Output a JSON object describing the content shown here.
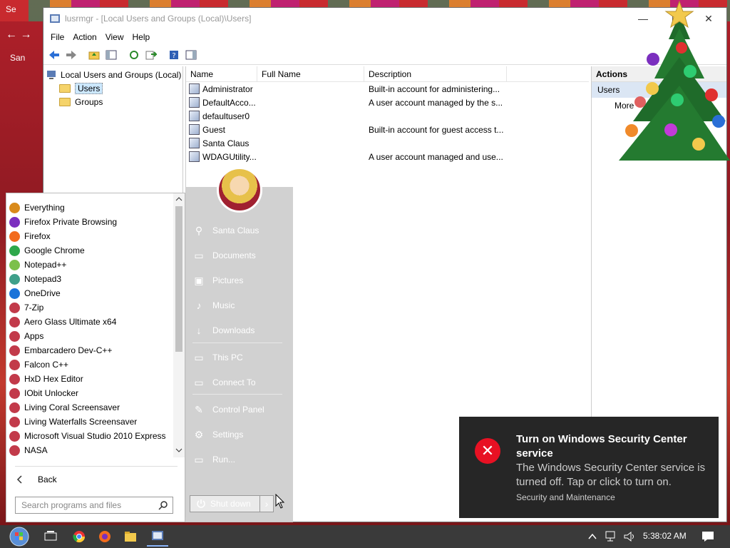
{
  "desktop": {
    "sec": "Se",
    "nav": "←  →",
    "san": "San"
  },
  "window": {
    "title": "lusrmgr - [Local Users and Groups (Local)\\Users]",
    "controls": {
      "minimize": "—",
      "maximize": "☐",
      "close": "✕"
    }
  },
  "menu": [
    "File",
    "Action",
    "View",
    "Help"
  ],
  "tree": {
    "root": "Local Users and Groups (Local)",
    "users": "Users",
    "groups": "Groups"
  },
  "list": {
    "headers": [
      "Name",
      "Full Name",
      "Description"
    ],
    "rows": [
      {
        "name": "Administrator",
        "full": "",
        "desc": "Built-in account for administering..."
      },
      {
        "name": "DefaultAcco...",
        "full": "",
        "desc": "A user account managed by the s..."
      },
      {
        "name": "defaultuser0",
        "full": "",
        "desc": ""
      },
      {
        "name": "Guest",
        "full": "",
        "desc": "Built-in account for guest access t..."
      },
      {
        "name": "Santa Claus",
        "full": "",
        "desc": ""
      },
      {
        "name": "WDAGUtility...",
        "full": "",
        "desc": "A user account managed and use..."
      }
    ]
  },
  "actions": {
    "header": "Actions",
    "users": "Users",
    "more": "More"
  },
  "start": {
    "programs": [
      {
        "label": "Everything",
        "color": "#d98a1a"
      },
      {
        "label": "Firefox Private Browsing",
        "color": "#7b2fbf"
      },
      {
        "label": "Firefox",
        "color": "#f26b1d"
      },
      {
        "label": "Google Chrome",
        "color": "#2ea84a"
      },
      {
        "label": "Notepad++",
        "color": "#7cc04a"
      },
      {
        "label": "Notepad3",
        "color": "#3fa08a"
      },
      {
        "label": "OneDrive",
        "color": "#1a73d9"
      },
      {
        "label": "7-Zip",
        "color": "#c23a4a"
      },
      {
        "label": "Aero Glass Ultimate x64",
        "color": "#c23a4a"
      },
      {
        "label": "Apps",
        "color": "#c23a4a"
      },
      {
        "label": "Embarcadero Dev-C++",
        "color": "#c23a4a"
      },
      {
        "label": "Falcon C++",
        "color": "#c23a4a"
      },
      {
        "label": "HxD Hex Editor",
        "color": "#c23a4a"
      },
      {
        "label": "IObit Unlocker",
        "color": "#c23a4a"
      },
      {
        "label": "Living Coral Screensaver",
        "color": "#c23a4a"
      },
      {
        "label": "Living Waterfalls Screensaver",
        "color": "#c23a4a"
      },
      {
        "label": "Microsoft Visual Studio 2010 Express",
        "color": "#c23a4a"
      },
      {
        "label": "NASA",
        "color": "#c23a4a"
      }
    ],
    "back": "Back",
    "search_placeholder": "Search programs and files",
    "right": [
      {
        "label": "Santa Claus",
        "icon": "⚲"
      },
      {
        "label": "Documents",
        "icon": "▭"
      },
      {
        "label": "Pictures",
        "icon": "▣"
      },
      {
        "label": "Music",
        "icon": "♪"
      },
      {
        "label": "Downloads",
        "icon": "↓"
      },
      {
        "label": "This PC",
        "icon": "▭"
      },
      {
        "label": "Connect To",
        "icon": "▭"
      },
      {
        "label": "Control Panel",
        "icon": "✎"
      },
      {
        "label": "Settings",
        "icon": "⚙"
      },
      {
        "label": "Run...",
        "icon": "▭"
      }
    ],
    "shutdown": "Shut down",
    "shutdown_arrow": "›"
  },
  "toast": {
    "title": "Turn on Windows Security Center service",
    "body": "The Windows Security Center service is turned off. Tap or click to turn on.",
    "source": "Security and Maintenance",
    "icon": "✕"
  },
  "taskbar": {
    "clock": "5:38:02 AM"
  }
}
